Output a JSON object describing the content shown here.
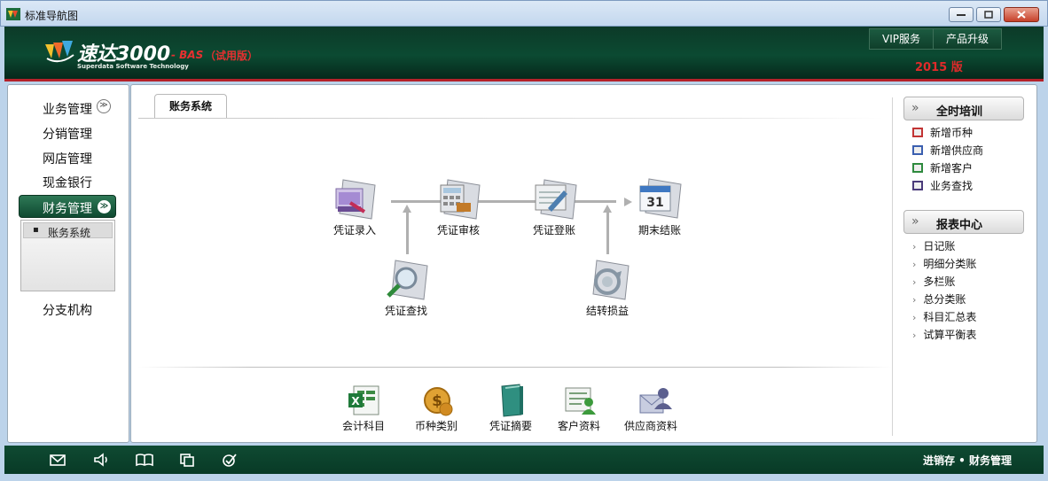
{
  "window": {
    "title": "标准导航图"
  },
  "header": {
    "logo_name": "速达3000",
    "logo_sub": "Superdata Software Technology",
    "edition": "- BAS",
    "trial": "（试用版）",
    "links": [
      "VIP服务",
      "产品升级"
    ],
    "year": "2015 版"
  },
  "sidebar": {
    "items": [
      "业务管理",
      "分销管理",
      "网店管理",
      "现金银行",
      "财务管理",
      "分支机构"
    ],
    "active": "财务管理",
    "submenu": [
      "账务系统"
    ]
  },
  "main": {
    "tab": "账务系统",
    "flow": [
      "凭证录入",
      "凭证审核",
      "凭证登账",
      "期末结账",
      "凭证查找",
      "结转损益"
    ],
    "calendar_day": "31",
    "bottom": [
      "会计科目",
      "币种类别",
      "凭证摘要",
      "客户资料",
      "供应商资料"
    ]
  },
  "right": {
    "training_title": "全时培训",
    "training_items": [
      "新增币种",
      "新增供应商",
      "新增客户",
      "业务查找"
    ],
    "report_title": "报表中心",
    "report_items": [
      "日记账",
      "明细分类账",
      "多栏账",
      "总分类账",
      "科目汇总表",
      "试算平衡表"
    ]
  },
  "status": {
    "text": "进销存 • 财务管理"
  },
  "colors": {
    "header_green": "#0b4a32",
    "accent_red": "#e02a2a",
    "status_green": "#0f4a32"
  }
}
